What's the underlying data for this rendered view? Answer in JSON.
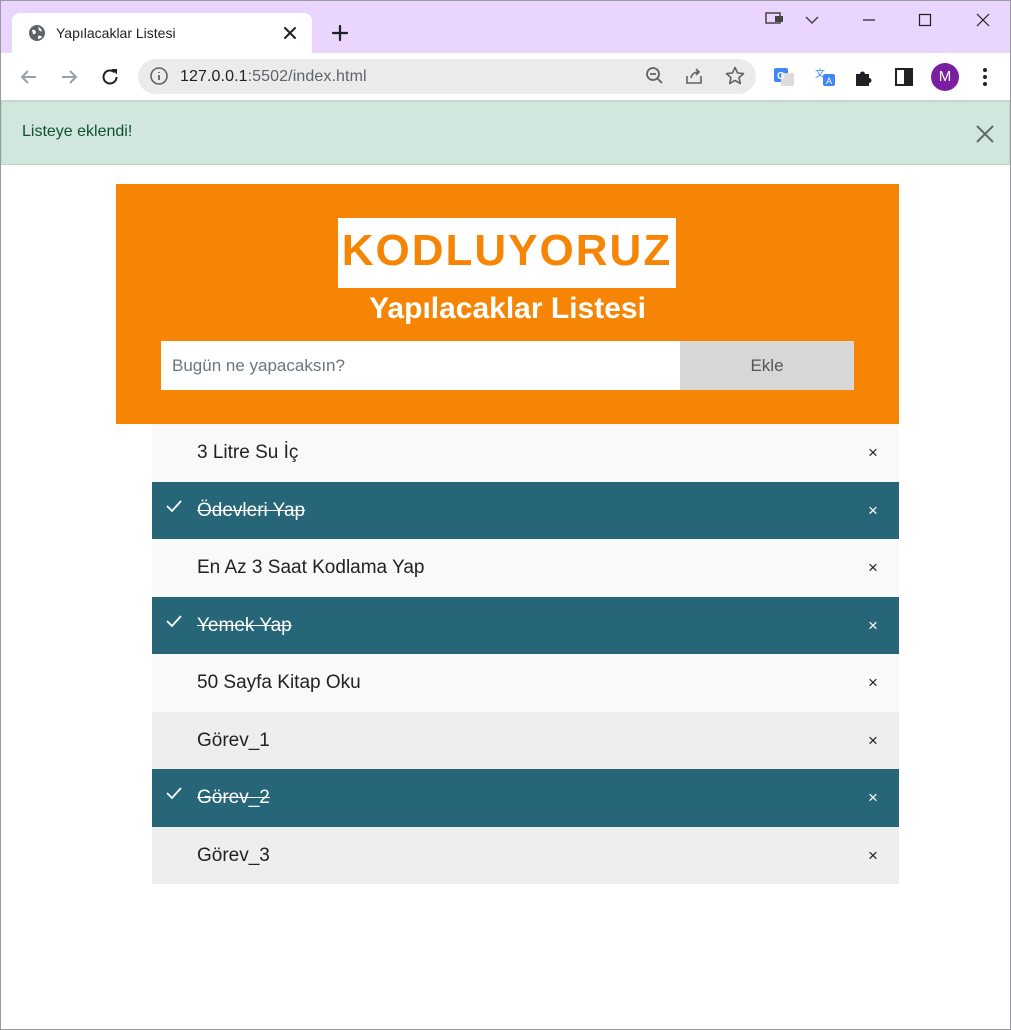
{
  "browser": {
    "tab_title": "Yapılacaklar Listesi",
    "url_host": "127.0.0.1",
    "url_rest": ":5502/index.html",
    "profile_initial": "M"
  },
  "alert": {
    "message": "Listeye eklendi!",
    "color": "#d1e7dd"
  },
  "header": {
    "logo_text": "KODLUYORUZ",
    "title": "Yapılacaklar Listesi",
    "input_placeholder": "Bugün ne yapacaksın?",
    "input_value": "",
    "add_label": "Ekle",
    "accent_color": "#f68505"
  },
  "tasks": [
    {
      "text": "3 Litre Su İç",
      "checked": false,
      "delete": "×"
    },
    {
      "text": "Ödevleri Yap",
      "checked": true,
      "delete": "×"
    },
    {
      "text": "En Az 3 Saat Kodlama Yap",
      "checked": false,
      "delete": "×"
    },
    {
      "text": "Yemek Yap",
      "checked": true,
      "delete": "×"
    },
    {
      "text": "50 Sayfa Kitap Oku",
      "checked": false,
      "delete": "×"
    },
    {
      "text": "Görev_1",
      "checked": false,
      "delete": "×"
    },
    {
      "text": "Görev_2",
      "checked": true,
      "delete": "×"
    },
    {
      "text": "Görev_3",
      "checked": false,
      "delete": "×"
    }
  ],
  "checked_color": "#276678"
}
